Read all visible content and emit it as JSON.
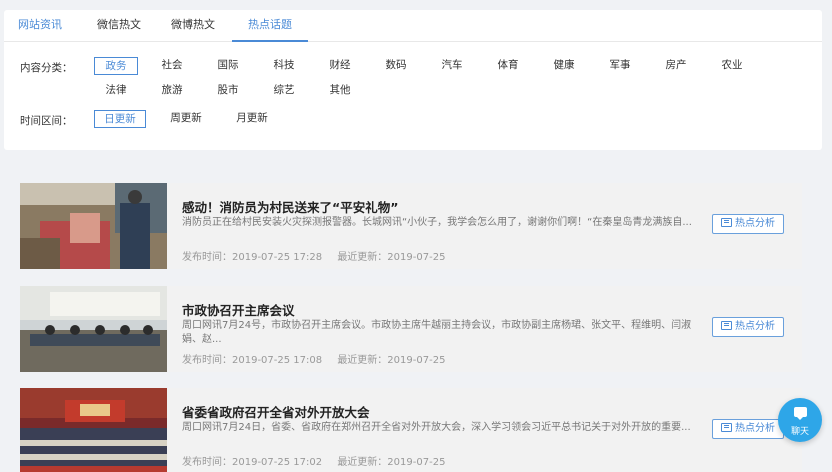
{
  "tabs": [
    "网站资讯",
    "微信热文",
    "微博热文",
    "热点话题"
  ],
  "filters": {
    "category_label": "内容分类：",
    "categories_row1": [
      "政务",
      "社会",
      "国际",
      "科技",
      "财经",
      "数码",
      "汽车",
      "体育",
      "健康",
      "军事",
      "房产",
      "农业"
    ],
    "categories_row2": [
      "法律",
      "旅游",
      "股市",
      "综艺",
      "其他"
    ],
    "time_label": "时间区间：",
    "time_options": [
      "日更新",
      "周更新",
      "月更新"
    ],
    "active_category": "政务",
    "active_time": "日更新"
  },
  "articles": [
    {
      "title": "感动！消防员为村民送来了“平安礼物”",
      "summary": "消防员正在给村民安装火灾探测报警器。长城网讯“小伙子，我学会怎么用了，谢谢你们啊！“在秦皇岛青龙满族自...",
      "publish": "发布时间：2019-07-25 17:28",
      "updated": "最近更新：2019-07-25",
      "button": "热点分析"
    },
    {
      "title": "市政协召开主席会议",
      "summary": "周口网讯7月24号，市政协召开主席会议。市政协主席牛越丽主持会议，市政协副主席杨珺、张文平、程维明、闫淑娟、赵...",
      "publish": "发布时间：2019-07-25 17:08",
      "updated": "最近更新：2019-07-25",
      "button": "热点分析"
    },
    {
      "title": "省委省政府召开全省对外开放大会",
      "summary": "周口网讯7月24日，省委、省政府在郑州召开全省对外开放大会，深入学习领会习近平总书记关于对外开放的重要...",
      "publish": "发布时间：2019-07-25 17:02",
      "updated": "最近更新：2019-07-25",
      "button": "热点分析"
    }
  ],
  "chat": {
    "label": "聊天"
  },
  "colors": {
    "accent": "#4a8ad6",
    "chat": "#2ea6e8"
  }
}
